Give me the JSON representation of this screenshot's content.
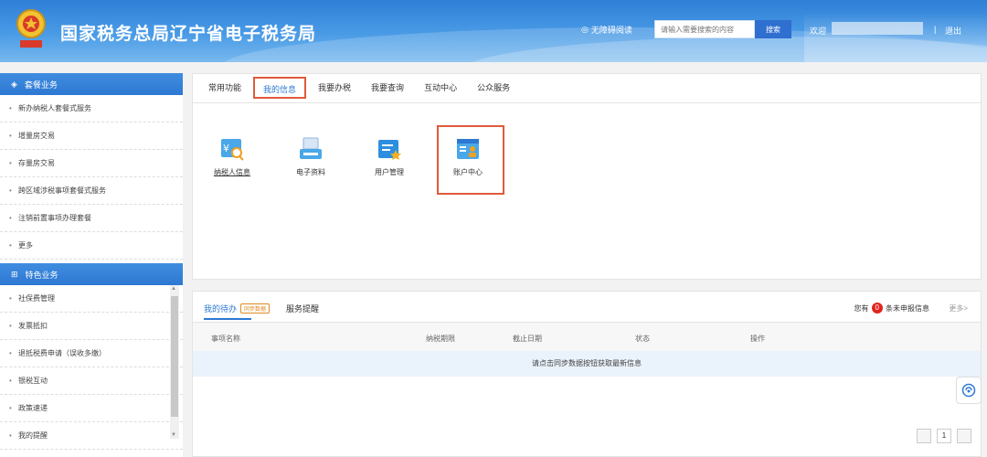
{
  "header": {
    "title": "国家税务总局辽宁省电子税务局",
    "accessible_label": "无障碍阅读",
    "search_placeholder": "请输入需要搜索的内容",
    "search_button": "搜索",
    "welcome": "欢迎",
    "separator": "|",
    "logout": "退出"
  },
  "sidebar": {
    "section1_title": "套餐业务",
    "section1_items": [
      "新办纳税人套餐式服务",
      "增量房交易",
      "存量房交易",
      "跨区域涉税事项套餐式服务",
      "注销前置事项办理套餐",
      "更多"
    ],
    "section2_title": "特色业务",
    "section2_items": [
      "社保费管理",
      "发票抵扣",
      "退抵税费申请（误收多缴）",
      "银税互动",
      "政策速递",
      "我的提醒"
    ]
  },
  "main": {
    "tabs": [
      "常用功能",
      "我的信息",
      "我要办税",
      "我要查询",
      "互动中心",
      "公众服务"
    ],
    "active_tab": 1,
    "functions": [
      "纳税人信息",
      "电子资料",
      "用户管理",
      "账户中心"
    ]
  },
  "todo": {
    "tab_todo": "我的待办",
    "sync_tag": "同步数据",
    "tab_remind": "服务提醒",
    "pending_prefix": "您有",
    "pending_count": "0",
    "pending_suffix": "条未申报信息",
    "more": "更多>",
    "columns": [
      "事项名称",
      "纳税期限",
      "截止日期",
      "状态",
      "操作"
    ],
    "empty_message": "请点击同步数据按钮获取最新信息",
    "page": "1"
  },
  "colors": {
    "header_blue": "#2e7fd6",
    "accent_blue": "#2d78d2",
    "highlight_red": "#e05a3c",
    "badge_red": "#e0231e"
  }
}
